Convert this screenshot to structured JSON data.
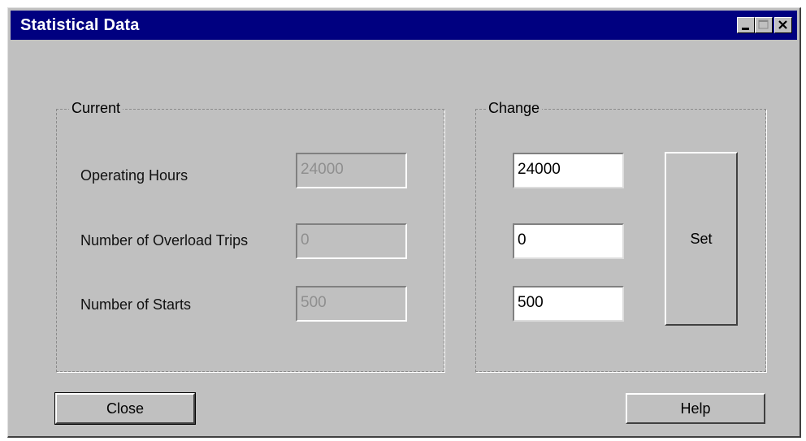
{
  "window": {
    "title": "Statistical Data"
  },
  "titlebar_buttons": {
    "minimize_icon": "minimize-icon",
    "maximize_icon": "maximize-icon",
    "close_icon": "close-icon"
  },
  "current": {
    "legend": "Current",
    "rows": [
      {
        "label": "Operating Hours",
        "value": "24000"
      },
      {
        "label": "Number of Overload Trips",
        "value": "0"
      },
      {
        "label": "Number of Starts",
        "value": "500"
      }
    ]
  },
  "change": {
    "legend": "Change",
    "values": [
      "24000",
      "0",
      "500"
    ],
    "set_label": "Set"
  },
  "buttons": {
    "close_label": "Close",
    "help_label": "Help"
  },
  "colors": {
    "titlebar": "#000080",
    "face": "#c0c0c0"
  }
}
